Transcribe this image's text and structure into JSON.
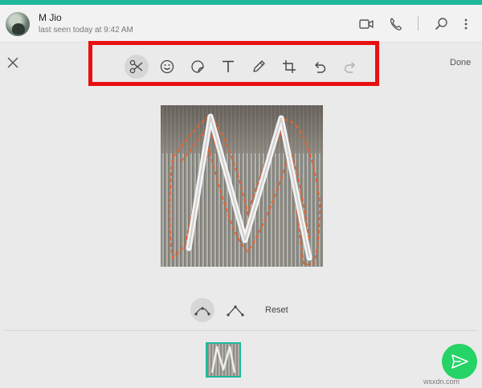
{
  "header": {
    "contact_name": "M Jio",
    "last_seen": "last seen today at 9:42 AM",
    "icons": [
      "video-call-icon",
      "voice-call-icon",
      "search-icon",
      "more-options-icon"
    ]
  },
  "editor": {
    "tools": [
      {
        "name": "scissors-icon",
        "active": true
      },
      {
        "name": "emoji-icon",
        "active": false
      },
      {
        "name": "sticker-icon",
        "active": false
      },
      {
        "name": "text-icon",
        "active": false
      },
      {
        "name": "pencil-icon",
        "active": false
      },
      {
        "name": "crop-rotate-icon",
        "active": false
      },
      {
        "name": "undo-icon",
        "active": false
      },
      {
        "name": "redo-icon",
        "active": false,
        "disabled": true
      }
    ],
    "done_label": "Done",
    "reset_label": "Reset"
  },
  "colors": {
    "accent": "#1fb89c",
    "highlight": "#e81010",
    "send": "#25d366",
    "cutout_path": "#e2622f"
  },
  "watermark": "wsxdn.com"
}
